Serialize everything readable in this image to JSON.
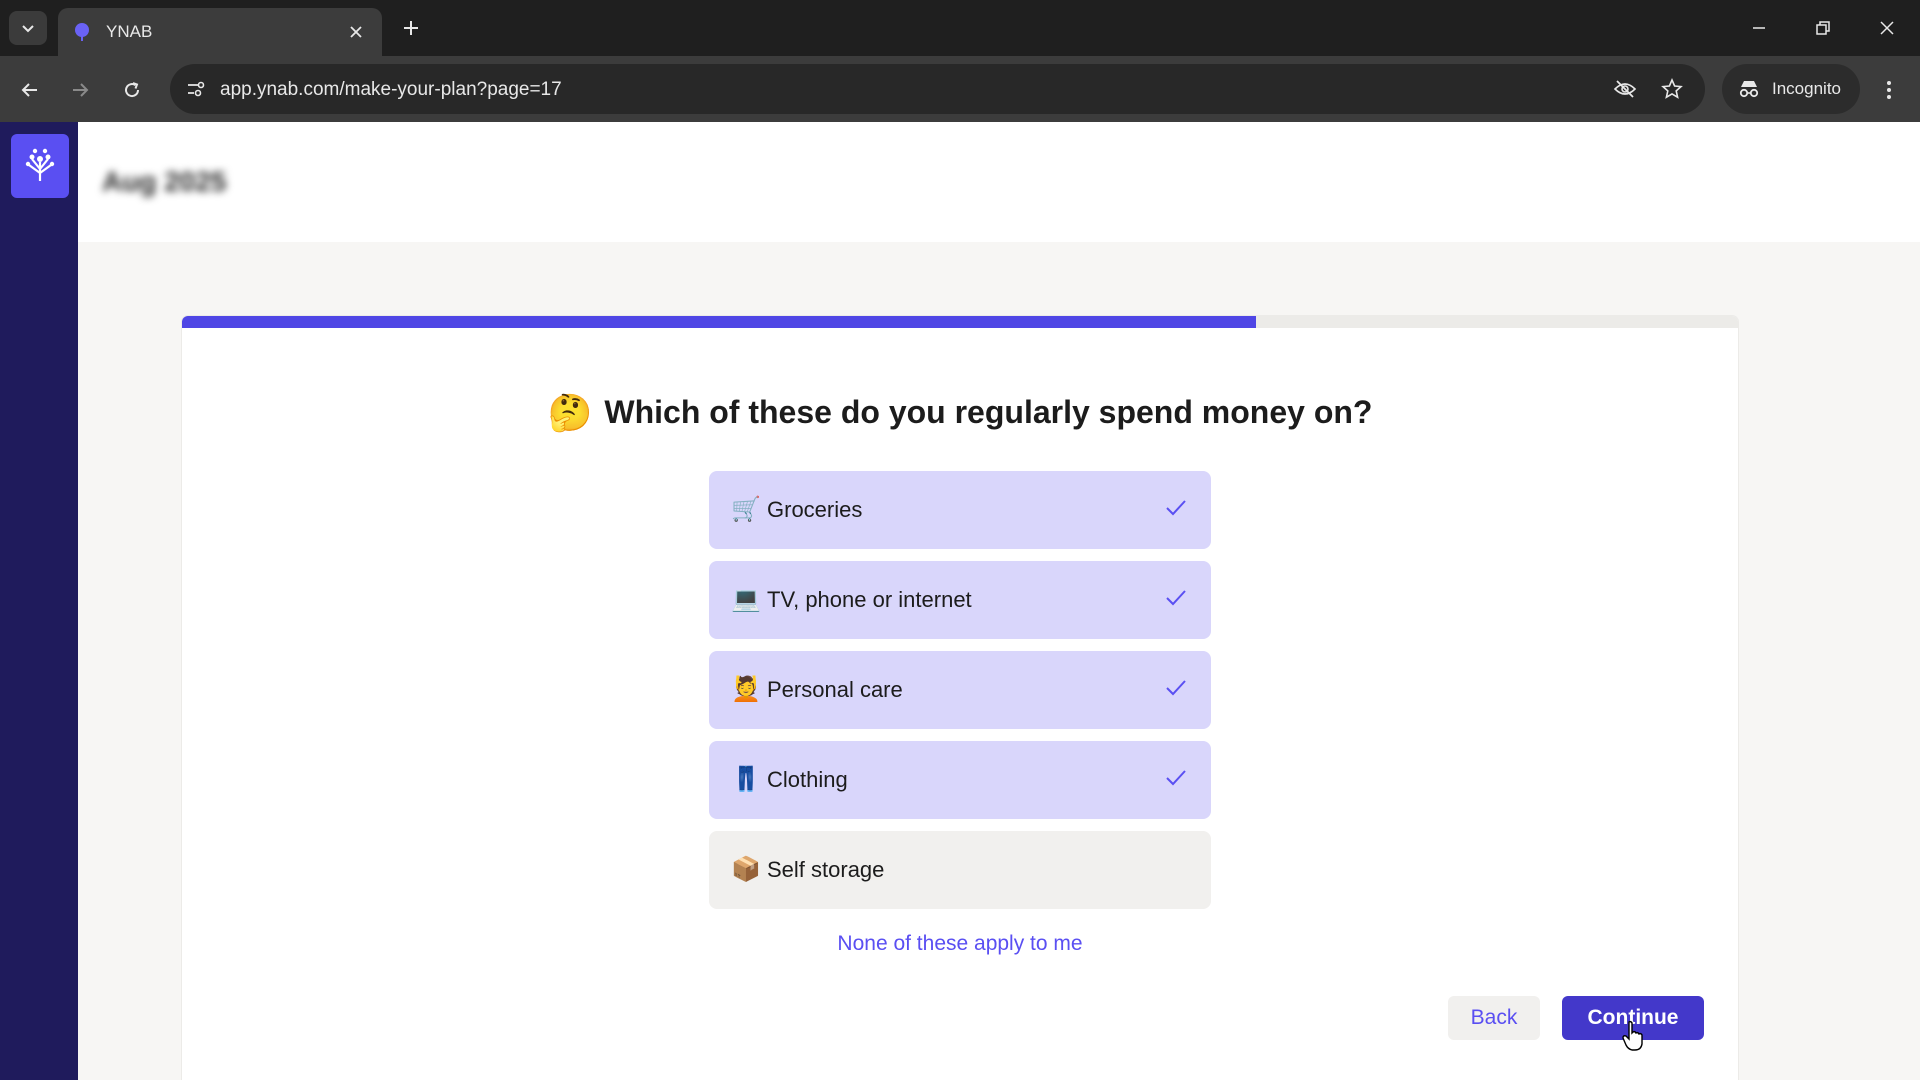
{
  "browser": {
    "tab_title": "YNAB",
    "url": "app.ynab.com/make-your-plan?page=17",
    "incognito_label": "Incognito"
  },
  "header": {
    "month": "Aug 2025"
  },
  "onboarding": {
    "progress": 0.69,
    "question_emoji": "🤔",
    "question": "Which of these do you regularly spend money on?",
    "options": [
      {
        "emoji": "🛒",
        "label": "Groceries",
        "selected": true
      },
      {
        "emoji": "💻",
        "label": "TV, phone or internet",
        "selected": true
      },
      {
        "emoji": "💆",
        "label": "Personal care",
        "selected": true
      },
      {
        "emoji": "👖",
        "label": "Clothing",
        "selected": true
      },
      {
        "emoji": "📦",
        "label": "Self storage",
        "selected": false
      }
    ],
    "none_link": "None of these apply to me",
    "back_label": "Back",
    "continue_label": "Continue"
  },
  "colors": {
    "accent": "#4f46e5",
    "selected_bg": "#d9d6fb",
    "sidebar": "#1f1b5c"
  }
}
